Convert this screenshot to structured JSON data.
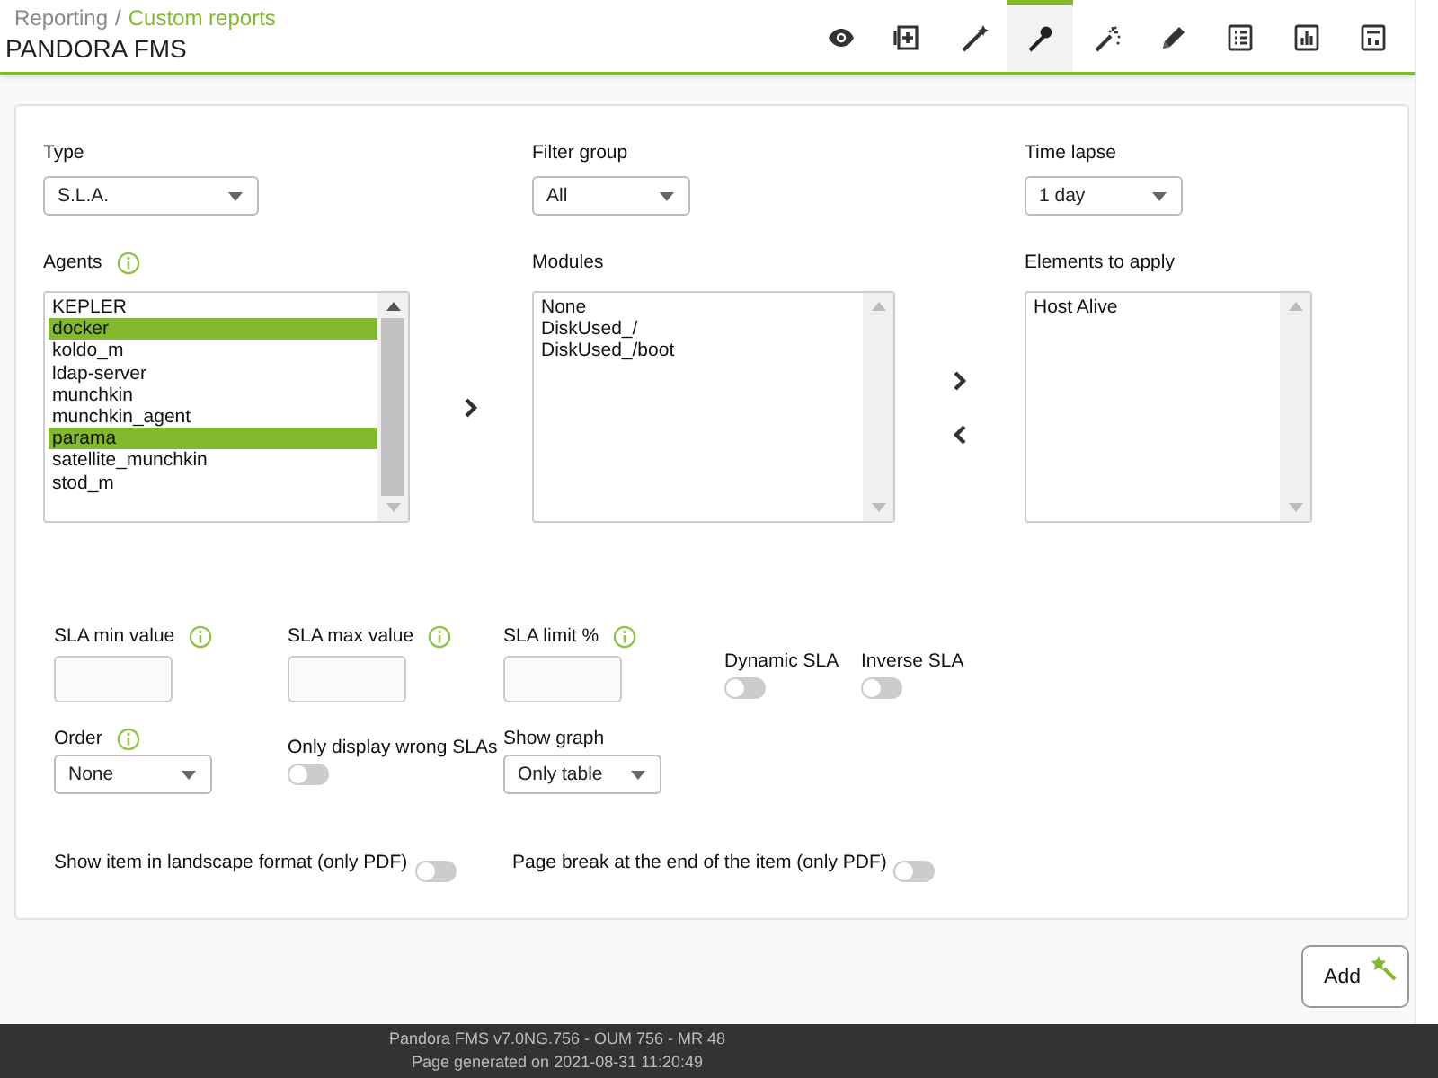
{
  "header": {
    "breadcrumb": [
      {
        "label": "Reporting",
        "current": false
      },
      {
        "label": "Custom reports",
        "current": true
      }
    ],
    "separator": "/",
    "title": "PANDORA FMS",
    "toolbar": [
      {
        "kind": "eye",
        "selected": false
      },
      {
        "kind": "add",
        "selected": false
      },
      {
        "kind": "wand",
        "selected": false
      },
      {
        "kind": "pin",
        "selected": true
      },
      {
        "kind": "sparkle",
        "selected": false
      },
      {
        "kind": "pencil",
        "selected": false
      },
      {
        "kind": "list",
        "selected": false
      },
      {
        "kind": "bars",
        "selected": false
      },
      {
        "kind": "panel",
        "selected": false
      }
    ]
  },
  "form": {
    "type": {
      "label": "Type",
      "value": "S.L.A."
    },
    "filter_group": {
      "label": "Filter group",
      "value": "All"
    },
    "time_lapse": {
      "label": "Time lapse",
      "value": "1 day"
    },
    "agents": {
      "label": "Agents",
      "info": true,
      "items": [
        {
          "label": "KEPLER",
          "selected": false
        },
        {
          "label": "docker",
          "selected": true
        },
        {
          "label": "koldo_m",
          "selected": false
        },
        {
          "label": "ldap-server",
          "selected": false
        },
        {
          "label": "munchkin",
          "selected": false
        },
        {
          "label": "munchkin_agent",
          "selected": false
        },
        {
          "label": "parama",
          "selected": true
        },
        {
          "label": "satellite_munchkin",
          "selected": false
        },
        {
          "label": "stod_m",
          "selected": false
        }
      ]
    },
    "modules": {
      "label": "Modules",
      "info": false,
      "items": [
        {
          "label": "None",
          "selected": false
        },
        {
          "label": "DiskUsed_/",
          "selected": false
        },
        {
          "label": "DiskUsed_/boot",
          "selected": false
        }
      ]
    },
    "elements": {
      "label": "Elements to apply",
      "info": false,
      "items": [
        {
          "label": "Host Alive",
          "selected": false
        }
      ]
    },
    "sla_min": {
      "label": "SLA min value",
      "info": true
    },
    "sla_max": {
      "label": "SLA max value",
      "info": true
    },
    "sla_limit": {
      "label": "SLA limit %",
      "info": true
    },
    "dynamic_sla": {
      "label": "Dynamic SLA",
      "on": false
    },
    "inverse_sla": {
      "label": "Inverse SLA",
      "on": false
    },
    "order": {
      "label": "Order",
      "info": true,
      "value": "None"
    },
    "only_wrong": {
      "label": "Only display wrong SLAs",
      "on": false
    },
    "show_graph": {
      "label": "Show graph",
      "info": false,
      "value": "Only table"
    },
    "landscape": {
      "label": "Show item in landscape format (only PDF)",
      "on": false
    },
    "page_break": {
      "label": "Page break at the end of the item (only PDF)",
      "on": false
    }
  },
  "add_button": {
    "label": "Add"
  },
  "footer": {
    "lines": [
      "Pandora FMS v7.0NG.756 - OUM 756 - MR 48",
      "Page generated on 2021-08-31 11:20:49"
    ]
  }
}
